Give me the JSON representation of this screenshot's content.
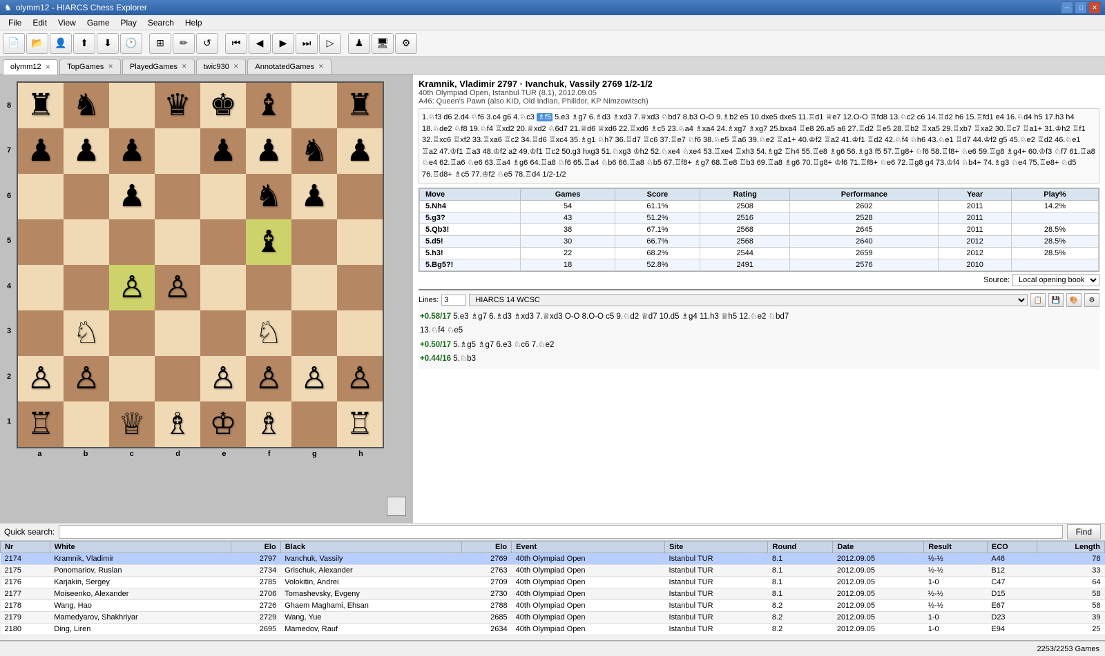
{
  "titlebar": {
    "title": "olymm12 - HIARCS Chess Explorer",
    "minimize": "─",
    "restore": "□",
    "close": "✕"
  },
  "menubar": {
    "items": [
      "File",
      "Edit",
      "View",
      "Game",
      "Play",
      "Search",
      "Help"
    ]
  },
  "tabs": [
    {
      "label": "olymm12",
      "active": true
    },
    {
      "label": "TopGames",
      "active": false
    },
    {
      "label": "PlayedGames",
      "active": false
    },
    {
      "label": "twic930",
      "active": false
    },
    {
      "label": "AnnotatedGames",
      "active": false
    }
  ],
  "game_header": {
    "players": "Kramnik, Vladimir 2797 · Ivanchuk, Vassily 2769  1/2-1/2",
    "event": "40th Olympiad Open, Istanbul TUR (8.1), 2012.09.05",
    "opening": "A46: Queen's Pawn (also KID, Old Indian, Philidor, KP Nimzowitsch)"
  },
  "moves": "1.♘f3 d6 2.d4 ♘f6 3.c4 g6 4.♘c3 ♗f5 5.e3 ♗g7 6.♗d3 ♗xd3 7.♕xd3 ♘bd7 8.b3 O-O 9.♗b2 e5 10.dxe5 dxe5 11.♖d1 ♕e7 12.O-O ♖fd8 13.♘c2 c6 14.♖d2 h6 15.♖fd1 e4 16.♘d4 h5 17.h3 h4 18.♘de2 ♘f8 19.♘f4 ♖xd2 20.♕xd2 ♘6d7 21.♕d6 ♕xd6 22.♖xd6 ♗c5 23.♘a4 ♗xa4 24.♗xg7 ♗xg7 25.bxa4 ♖e8 26.a5 a6 27.♖d2 ♖e5 28.♖b2 ♖xa5 29.♖xb7 ♖xa2 30.♖c7 ♖a1+ 31.♔h2 ♖f1 32.♖xc6 ♖xf2 33.♖xa6 ♖c2 34.♖d6 ♖xc4 35.♗g1 ♘h7 36.♖d7 ♖c6 37.♖e7 ♘f6 38.♘e5 ♖a6 39.♘e2 ♖a1+ 40.♔f2 ♖a2 41.♔f1 ♖d2 42.♘f4 ♘h6 43.♘e1 ♖d7 44.♔f2 g5 45.♘e2 ♖d2 46.♘e1 ♖a2 47.♔f1 ♖a3 48.♔f2 a2 49.♔f1 ♖c2 50.g3 hxg3 51.♘xg3 ♔h2 52.♘xe4 ♘xe4 53.♖xe4 ♖xh3 54.♗g2 ♖h4 55.♖e8 ♗g6 56.♗g3 f5 57.♖g8+ ♘f6 58.♖f8+ ♘e6 59.♖g8 ♗g4+ 60.♔f3 ♘f7 61.♖a8 ♘e4 62.♖a6 ♘e6 63.♖a4 ♗g6 64.♖a8 ♘f6 65.♖a4 ♘b6 66.♖a8 ♘b5 67.♖f8+ ♗g7 68.♖e8 ♖b3 69.♖a8 ♗g6 70.♖g8+ ♔f6 71.♖f8+ ♘e6 72.♖g8 g4 73.♔f4 ♘b4+ 74.♗g3 ♘e4 75.♖e8+ ♘d5 76.♖d8+ ♗c5 77.♔f2 ♘e5 78.♖d4 1/2-1/2",
  "book_table": {
    "headers": [
      "Move",
      "Games",
      "Score",
      "Rating",
      "Performance",
      "Year",
      "Play%"
    ],
    "rows": [
      {
        "move": "5.Nh4",
        "games": 54,
        "score": "61.1%",
        "rating": 2508,
        "performance": 2602,
        "year": 2011,
        "play": "14.2%"
      },
      {
        "move": "5.g3?",
        "games": 43,
        "score": "51.2%",
        "rating": 2516,
        "performance": 2528,
        "year": 2011,
        "play": ""
      },
      {
        "move": "5.Qb3!",
        "games": 38,
        "score": "67.1%",
        "rating": 2568,
        "performance": 2645,
        "year": 2011,
        "play": "28.5%"
      },
      {
        "move": "5.d5!",
        "games": 30,
        "score": "66.7%",
        "rating": 2568,
        "performance": 2640,
        "year": 2012,
        "play": "28.5%"
      },
      {
        "move": "5.h3!",
        "games": 22,
        "score": "68.2%",
        "rating": 2544,
        "performance": 2659,
        "year": 2012,
        "play": "28.5%"
      },
      {
        "move": "5.Bg5?!",
        "games": 18,
        "score": "52.8%",
        "rating": 2491,
        "performance": 2576,
        "year": 2010,
        "play": ""
      }
    ]
  },
  "source_label": "Source:",
  "source_value": "Local opening book",
  "engine": {
    "lines_label": "Lines:",
    "lines_value": "3",
    "engine_name": "HIARCS 14 WCSC",
    "line1": "+0.58/17  5.e3  ♗g7  6.♗d3  ♗xd3  7.♕xd3  O-O  8.O-O  c5  9.♘d2  ♕d7  10.d5  ♗g4  11.h3  ♕h5  12.♘e2  ♘bd7",
    "line1_cont": "13.♘f4  ♘e5",
    "line2": "+0.50/17  5.♗g5  ♗g7  6.e3  ♘c6  7.♘e2",
    "line3": "+0.44/16  5.♘b3"
  },
  "quick_search": {
    "label": "Quick search:",
    "placeholder": "",
    "find_btn": "Find"
  },
  "games_table": {
    "headers": [
      "Nr",
      "White",
      "Elo",
      "Black",
      "Elo",
      "Event",
      "Site",
      "Round",
      "Date",
      "Result",
      "ECO",
      "Length"
    ],
    "rows": [
      {
        "nr": 2174,
        "white": "Kramnik, Vladimir",
        "welo": 2797,
        "black": "Ivanchuk, Vassily",
        "belo": 2769,
        "event": "40th Olympiad Open",
        "site": "Istanbul TUR",
        "round": "8.1",
        "date": "2012.09.05",
        "result": "½-½",
        "eco": "A46",
        "length": 78,
        "selected": true
      },
      {
        "nr": 2175,
        "white": "Ponomariov, Ruslan",
        "welo": 2734,
        "black": "Grischuk, Alexander",
        "belo": 2763,
        "event": "40th Olympiad Open",
        "site": "Istanbul TUR",
        "round": "8.1",
        "date": "2012.09.05",
        "result": "½-½",
        "eco": "B12",
        "length": 33
      },
      {
        "nr": 2176,
        "white": "Karjakin, Sergey",
        "welo": 2785,
        "black": "Volokitin, Andrei",
        "belo": 2709,
        "event": "40th Olympiad Open",
        "site": "Istanbul TUR",
        "round": "8.1",
        "date": "2012.09.05",
        "result": "1-0",
        "eco": "C47",
        "length": 64
      },
      {
        "nr": 2177,
        "white": "Moiseenko, Alexander",
        "welo": 2706,
        "black": "Tomashevsky, Evgeny",
        "belo": 2730,
        "event": "40th Olympiad Open",
        "site": "Istanbul TUR",
        "round": "8.1",
        "date": "2012.09.05",
        "result": "½-½",
        "eco": "D15",
        "length": 58
      },
      {
        "nr": 2178,
        "white": "Wang, Hao",
        "welo": 2726,
        "black": "Ghaem Maghami, Ehsan",
        "belo": 2788,
        "event": "40th Olympiad Open",
        "site": "Istanbul TUR",
        "round": "8.2",
        "date": "2012.09.05",
        "result": "½-½",
        "eco": "E67",
        "length": 58
      },
      {
        "nr": 2179,
        "white": "Mamedyarov, Shakhriyar",
        "welo": 2729,
        "black": "Wang, Yue",
        "belo": 2685,
        "event": "40th Olympiad Open",
        "site": "Istanbul TUR",
        "round": "8.2",
        "date": "2012.09.05",
        "result": "1-0",
        "eco": "D23",
        "length": 39
      },
      {
        "nr": 2180,
        "white": "Ding, Liren",
        "welo": 2695,
        "black": "Mamedov, Rauf",
        "belo": 2634,
        "event": "40th Olympiad Open",
        "site": "Istanbul TUR",
        "round": "8.2",
        "date": "2012.09.05",
        "result": "1-0",
        "eco": "E94",
        "length": 25
      }
    ]
  },
  "statusbar": {
    "count": "2253/2253 Games"
  },
  "board": {
    "position": [
      [
        "♜",
        "♞",
        "",
        "♛",
        "♚",
        "♝",
        "",
        "♜"
      ],
      [
        "♟",
        "♟",
        "♟",
        "",
        "♟",
        "♟",
        "♞",
        "♟"
      ],
      [
        "",
        "",
        "♟",
        "",
        "",
        "♞",
        "♟",
        ""
      ],
      [
        "",
        "",
        "",
        "",
        "",
        "♝",
        "",
        ""
      ],
      [
        "",
        "",
        "♙",
        "♙",
        "",
        "",
        "",
        ""
      ],
      [
        "",
        "♘",
        "",
        "",
        "",
        "♘",
        "",
        ""
      ],
      [
        "♙",
        "♙",
        "",
        "",
        "♙",
        "♙",
        "♙",
        "♙"
      ],
      [
        "♖",
        "",
        "♕",
        "♗",
        "♔",
        "♗",
        "",
        "♖"
      ]
    ]
  }
}
